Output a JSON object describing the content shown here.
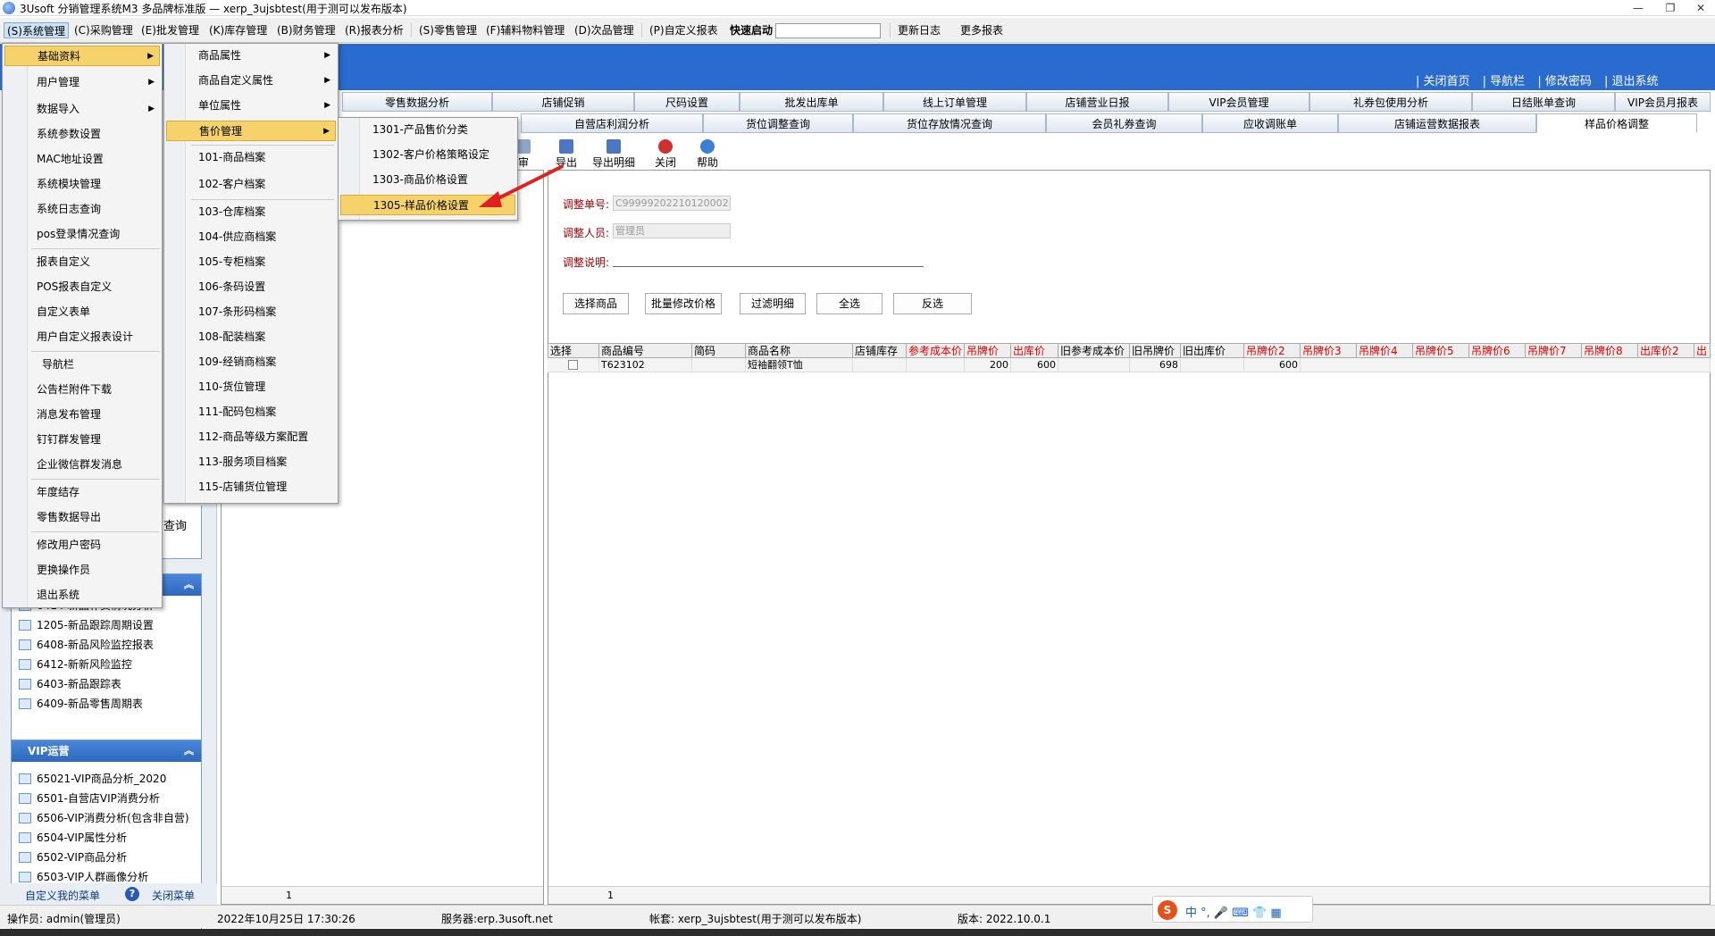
{
  "title": "3Usoft 分销管理系统M3 多品牌标准版 — xerp_3ujsbtest(用于测可以发布版本)",
  "window_buttons": [
    "—",
    "❐",
    "✕"
  ],
  "menubar": {
    "items": [
      "(S)系统管理",
      "(C)采购管理",
      "(E)批发管理",
      "(K)库存管理",
      "(B)财务管理",
      "(R)报表分析",
      "(S)零售管理",
      "(F)辅料物料管理",
      "(D)次品管理",
      "(P)自定义报表"
    ],
    "quick_label": "快速启动",
    "changelog": "更新日志",
    "more_reports": "更多报表"
  },
  "header_links": [
    "| 关闭首页",
    "| 导航栏",
    "| 修改密码",
    "| 退出系统"
  ],
  "tabs_row1": [
    "零售数据分析",
    "店铺促销",
    "尺码设置",
    "批发出库单",
    "线上订单管理",
    "店铺营业日报",
    "VIP会员管理",
    "礼券包使用分析",
    "日结账单查询",
    "VIP会员月报表"
  ],
  "tabs_row2": [
    "自营店利润分析",
    "货位调整查询",
    "货位存放情况查询",
    "会员礼券查询",
    "应收调账单",
    "店铺运营数据报表",
    "样品价格调整"
  ],
  "toolbar": {
    "audit": "审",
    "export": "导出",
    "export_detail": "导出明细",
    "close": "关闭",
    "help": "帮助"
  },
  "form": {
    "doc_no_label": "调整单号:",
    "doc_no_value": "C99999202210120002",
    "operator_label": "调整人员:",
    "operator_value": "管理员",
    "remark_label": "调整说明:"
  },
  "buttons": [
    "选择商品",
    "批量修改价格",
    "过滤明细",
    "全选",
    "反选"
  ],
  "grid": {
    "headers": [
      {
        "label": "选择",
        "red": false
      },
      {
        "label": "商品编号",
        "red": false
      },
      {
        "label": "简码",
        "red": false
      },
      {
        "label": "商品名称",
        "red": false
      },
      {
        "label": "店铺库存",
        "red": false
      },
      {
        "label": "参考成本价",
        "red": true
      },
      {
        "label": "吊牌价",
        "red": true
      },
      {
        "label": "出库价",
        "red": true
      },
      {
        "label": "旧参考成本价",
        "red": false
      },
      {
        "label": "旧吊牌价",
        "red": false
      },
      {
        "label": "旧出库价",
        "red": false
      },
      {
        "label": "吊牌价2",
        "red": true
      },
      {
        "label": "吊牌价3",
        "red": true
      },
      {
        "label": "吊牌价4",
        "red": true
      },
      {
        "label": "吊牌价5",
        "red": true
      },
      {
        "label": "吊牌价6",
        "red": true
      },
      {
        "label": "吊牌价7",
        "red": true
      },
      {
        "label": "吊牌价8",
        "red": true
      },
      {
        "label": "出库价2",
        "red": true
      },
      {
        "label": "出",
        "red": true
      }
    ],
    "row": {
      "code": "T623102",
      "name": "短袖翻领T恤",
      "tag_price": "200",
      "out_price": "600",
      "old_tag": "698",
      "price2": "600"
    }
  },
  "pager_left": "1",
  "pager_right": "1",
  "left_groups": {
    "g1_items": [
      "6414-新品补货情况分析",
      "1205-新品跟踪周期设置",
      "6408-新品风险监控报表",
      "6412-新新风险监控",
      "6403-新品跟踪表",
      "6409-新品零售周期表"
    ],
    "partial_text": "查询",
    "g2_title": "VIP运营",
    "g2_items": [
      "65021-VIP商品分析_2020",
      "6501-自营店VIP消费分析",
      "6506-VIP消费分析(包含非自营)",
      "6504-VIP属性分析",
      "6502-VIP商品分析",
      "6503-VIP人群画像分析"
    ],
    "custom_menu": "自定义我的菜单",
    "close_menu": "关闭菜单"
  },
  "menu1": [
    "基础资料",
    "用户管理",
    "数据导入",
    "系统参数设置",
    "MAC地址设置",
    "系统模块管理",
    "系统日志查询",
    "pos登录情况查询",
    "报表自定义",
    "POS报表自定义",
    "自定义表单",
    "用户自定义报表设计",
    "导航栏",
    "公告栏附件下载",
    "消息发布管理",
    "钉钉群发管理",
    "企业微信群发消息",
    "年度结存",
    "零售数据导出",
    "修改用户密码",
    "更换操作员",
    "退出系统"
  ],
  "menu2": [
    "商品属性",
    "商品自定义属性",
    "单位属性",
    "售价管理",
    "101-商品档案",
    "102-客户档案",
    "103-仓库档案",
    "104-供应商档案",
    "105-专柜档案",
    "106-条码设置",
    "107-条形码档案",
    "108-配装档案",
    "109-经销商档案",
    "110-货位管理",
    "111-配码包档案",
    "112-商品等级方案配置",
    "113-服务项目档案",
    "115-店铺货位管理"
  ],
  "menu3": [
    "1301-产品售价分类",
    "1302-客户价格策略设定",
    "1303-商品价格设置",
    "1305-样品价格设置"
  ],
  "status": {
    "operator": "操作员: admin(管理员)",
    "datetime": "2022年10月25日 17:30:26",
    "server": "服务器:erp.3usoft.net",
    "account": "帐套: xerp_3ujsbtest(用于测可以发布版本)",
    "version": "版本: 2022.10.0.1"
  },
  "ime": {
    "logo": "S",
    "chars": "中 °, 🎤 ⌨ 👕 ▦"
  }
}
